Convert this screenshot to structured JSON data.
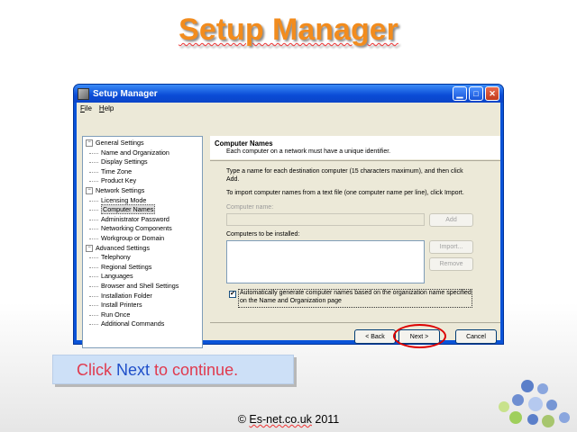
{
  "slide": {
    "title": "Setup Manager",
    "caption_click": "Click ",
    "caption_next": "Next",
    "caption_rest": " to continue.",
    "copyright_prefix": "© ",
    "copyright_brand": "Es-net.co.uk",
    "copyright_year": " 2011"
  },
  "window": {
    "title": "Setup Manager",
    "menu": [
      "File",
      "Help"
    ]
  },
  "tree": [
    {
      "label": "General Settings",
      "level": 0,
      "expander": "−"
    },
    {
      "label": "Name and Organization",
      "level": 1
    },
    {
      "label": "Display Settings",
      "level": 1
    },
    {
      "label": "Time Zone",
      "level": 1
    },
    {
      "label": "Product Key",
      "level": 1
    },
    {
      "label": "Network Settings",
      "level": 0,
      "expander": "−"
    },
    {
      "label": "Licensing Mode",
      "level": 1
    },
    {
      "label": "Computer Names",
      "level": 1,
      "selected": true
    },
    {
      "label": "Administrator Password",
      "level": 1
    },
    {
      "label": "Networking Components",
      "level": 1
    },
    {
      "label": "Workgroup or Domain",
      "level": 1
    },
    {
      "label": "Advanced Settings",
      "level": 0,
      "expander": "−"
    },
    {
      "label": "Telephony",
      "level": 1
    },
    {
      "label": "Regional Settings",
      "level": 1
    },
    {
      "label": "Languages",
      "level": 1
    },
    {
      "label": "Browser and Shell Settings",
      "level": 1
    },
    {
      "label": "Installation Folder",
      "level": 1
    },
    {
      "label": "Install Printers",
      "level": 1
    },
    {
      "label": "Run Once",
      "level": 1
    },
    {
      "label": "Additional Commands",
      "level": 1
    }
  ],
  "panel": {
    "heading": "Computer Names",
    "subheading": "Each computer on a network must have a unique identifier.",
    "instructions_line1": "Type a name for each destination computer (15 characters maximum), and then click",
    "instructions_line2": "Add.",
    "import_text": "To import computer names from a text file (one computer name per line), click Import.",
    "computer_name_label": "Computer name:",
    "computer_name_value": "",
    "add_label": "Add",
    "to_install_label": "Computers to be installed:",
    "import_label": "Import...",
    "remove_label": "Remove",
    "auto_checked": true,
    "auto_label_line1": "Automatically generate computer names based on the organization name specified",
    "auto_label_line2": "on the Name and Organization page"
  },
  "buttons": {
    "back": "< Back",
    "next": "Next >",
    "cancel": "Cancel"
  },
  "colors": {
    "title_orange": "#f28c1e",
    "xp_blue": "#0a53d8",
    "highlight_red": "#d00000",
    "caption_bg": "#cde0f7"
  }
}
